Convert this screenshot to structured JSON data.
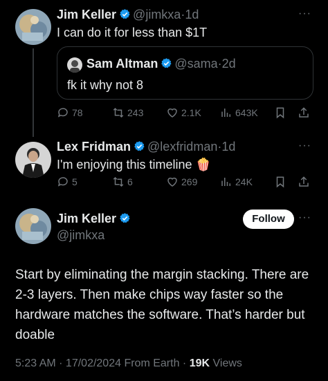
{
  "colors": {
    "accent": "#1d9bf0",
    "muted": "#71767b",
    "text": "#e7e9ea",
    "background": "#000000"
  },
  "tweet1": {
    "author_name": "Jim Keller",
    "author_handle": "@jimkxa",
    "time": "1d",
    "text": "I can do it for less than $1T",
    "quote": {
      "author_name": "Sam Altman",
      "author_handle": "@sama",
      "time": "2d",
      "text": "fk it why not 8"
    },
    "stats": {
      "replies": "78",
      "retweets": "243",
      "likes": "2.1K",
      "views": "643K"
    }
  },
  "tweet2": {
    "author_name": "Lex Fridman",
    "author_handle": "@lexfridman",
    "time": "1d",
    "text": "I'm enjoying this timeline",
    "emoji": "🍿",
    "stats": {
      "replies": "5",
      "retweets": "6",
      "likes": "269",
      "views": "24K"
    }
  },
  "main_tweet": {
    "author_name": "Jim Keller",
    "author_handle": "@jimkxa",
    "follow_label": "Follow",
    "text": "Start by eliminating the margin stacking. There are 2-3 layers. Then make chips way faster so the hardware matches the software. That’s harder but doable",
    "timestamp": "5:23 AM · 17/02/2024 From Earth ·",
    "views_count": "19K",
    "views_label": "Views"
  },
  "separator": "·",
  "more_label": "···"
}
